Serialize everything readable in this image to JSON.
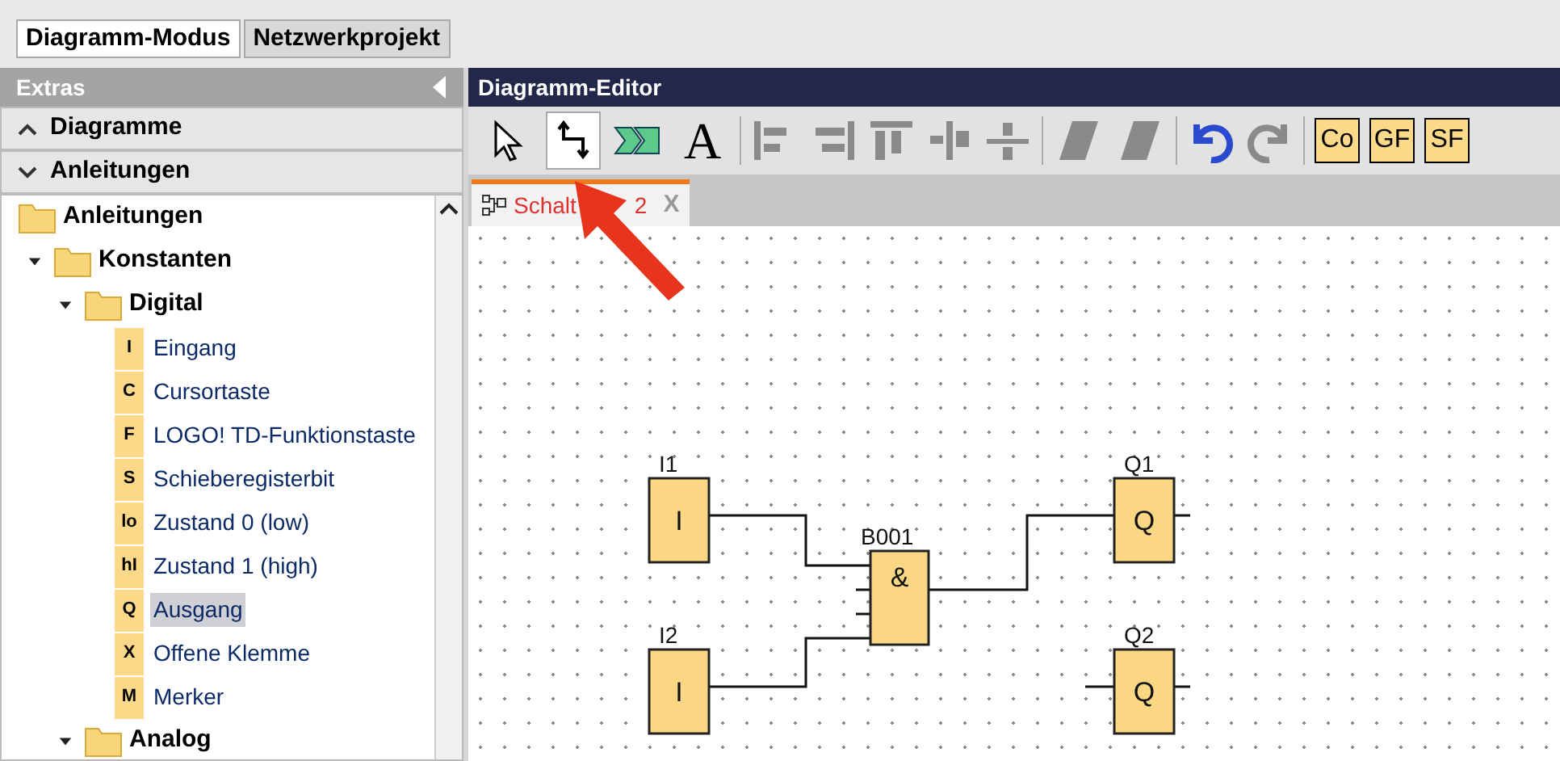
{
  "mode_tabs": [
    {
      "label": "Diagramm-Modus",
      "selected": true
    },
    {
      "label": "Netzwerkprojekt",
      "selected": false
    }
  ],
  "sidebar": {
    "title": "Extras",
    "sections": [
      {
        "label": "Diagramme",
        "expanded": false
      },
      {
        "label": "Anleitungen",
        "expanded": true
      }
    ],
    "tree": [
      {
        "label": "Anleitungen",
        "children": [
          {
            "label": "Konstanten",
            "expanded": true,
            "children": [
              {
                "label": "Digital",
                "expanded": true,
                "children": [
                  {
                    "badge": "I",
                    "label": "Eingang",
                    "selected": false
                  },
                  {
                    "badge": "C",
                    "label": "Cursortaste",
                    "selected": false
                  },
                  {
                    "badge": "F",
                    "label": "LOGO! TD-Funktionstaste",
                    "selected": false
                  },
                  {
                    "badge": "S",
                    "label": "Schieberegisterbit",
                    "selected": false
                  },
                  {
                    "badge": "lo",
                    "label": "Zustand 0 (low)",
                    "selected": false
                  },
                  {
                    "badge": "hI",
                    "label": "Zustand 1 (high)",
                    "selected": false
                  },
                  {
                    "badge": "Q",
                    "label": "Ausgang",
                    "selected": true
                  },
                  {
                    "badge": "X",
                    "label": "Offene Klemme",
                    "selected": false
                  },
                  {
                    "badge": "M",
                    "label": "Merker",
                    "selected": false
                  }
                ]
              },
              {
                "label": "Analog",
                "expanded": true
              }
            ]
          }
        ]
      }
    ]
  },
  "editor": {
    "title": "Diagramm-Editor",
    "tools": [
      {
        "selected": false
      },
      {
        "selected": true
      },
      {
        "selected": false
      },
      {
        "selected": false,
        "glyph": "A"
      }
    ],
    "align_tools": [
      {
        "disabled": true
      },
      {
        "disabled": true
      },
      {
        "disabled": true
      },
      {
        "disabled": true
      },
      {
        "disabled": true
      }
    ],
    "group_tools": [
      {
        "disabled": true
      },
      {
        "disabled": true
      }
    ],
    "history": [
      {
        "disabled": false
      },
      {
        "disabled": true
      }
    ],
    "block_buttons": [
      "Co",
      "GF",
      "SF"
    ],
    "tab": {
      "label_parts": [
        "Schalt",
        "2"
      ],
      "close": "X"
    },
    "diagram": {
      "blocks": [
        {
          "kind": "input",
          "name": "I1",
          "symbol": "I"
        },
        {
          "kind": "input",
          "name": "I2",
          "symbol": "I"
        },
        {
          "kind": "gate",
          "name": "B001",
          "symbol": "&"
        },
        {
          "kind": "output",
          "name": "Q1",
          "symbol": "Q"
        },
        {
          "kind": "output",
          "name": "Q2",
          "symbol": "Q"
        }
      ]
    }
  }
}
